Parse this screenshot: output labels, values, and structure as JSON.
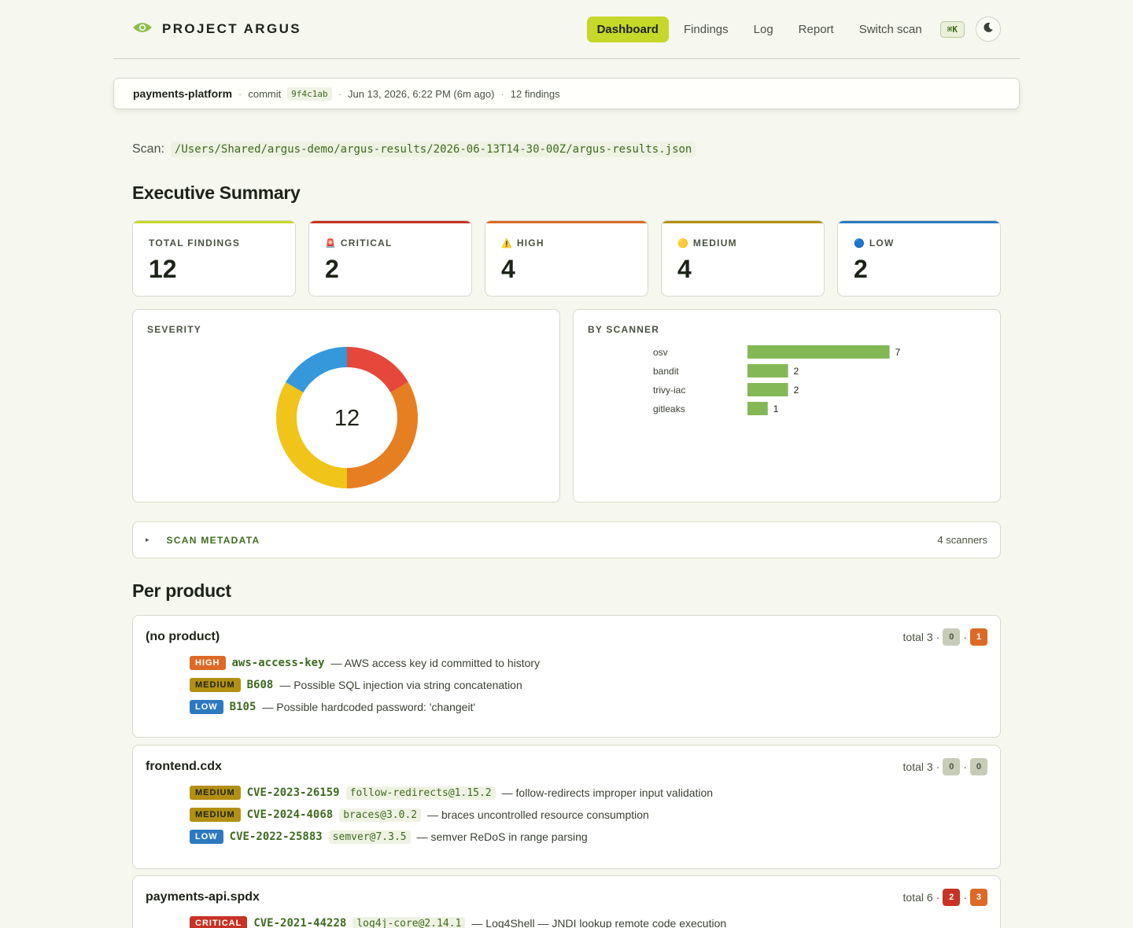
{
  "brand": {
    "name": "PROJECT ARGUS"
  },
  "nav": {
    "items": [
      {
        "label": "Dashboard",
        "active": true
      },
      {
        "label": "Findings",
        "active": false
      },
      {
        "label": "Log",
        "active": false
      },
      {
        "label": "Report",
        "active": false
      },
      {
        "label": "Switch scan",
        "active": false
      }
    ],
    "shortcut": "⌘K",
    "theme_icon": "moon-icon"
  },
  "scan_info": {
    "repo": "payments-platform",
    "commit_label": "commit",
    "commit": "9f4c1ab",
    "time": "Jun 13, 2026, 6:22 PM (6m ago)",
    "findings": "12 findings"
  },
  "scan_path": {
    "label": "Scan:",
    "path": "/Users/Shared/argus-demo/argus-results/2026-06-13T14-30-00Z/argus-results.json"
  },
  "summary": {
    "heading": "Executive Summary",
    "cards": [
      {
        "label": "TOTAL FINDINGS",
        "icon": "",
        "value": "12",
        "color": "#c6d82a"
      },
      {
        "label": "CRITICAL",
        "icon": "🚨",
        "value": "2",
        "color": "#c73324"
      },
      {
        "label": "HIGH",
        "icon": "⚠️",
        "value": "4",
        "color": "#dc6a26"
      },
      {
        "label": "MEDIUM",
        "icon": "🟡",
        "value": "4",
        "color": "#b29013"
      },
      {
        "label": "LOW",
        "icon": "🔵",
        "value": "2",
        "color": "#2d79c1"
      }
    ]
  },
  "severity_panel": {
    "title": "SEVERITY",
    "center": "12"
  },
  "scanner_panel": {
    "title": "BY SCANNER"
  },
  "chart_data": [
    {
      "type": "pie",
      "title": "SEVERITY",
      "categories": [
        "Critical",
        "High",
        "Medium",
        "Low"
      ],
      "values": [
        2,
        4,
        4,
        2
      ],
      "colors": [
        "#e5483b",
        "#e67e22",
        "#f0c419",
        "#3498db"
      ],
      "center_label": "12"
    },
    {
      "type": "bar",
      "title": "BY SCANNER",
      "categories": [
        "osv",
        "bandit",
        "trivy-iac",
        "gitleaks"
      ],
      "values": [
        7,
        2,
        2,
        1
      ],
      "color": "#84b857",
      "orientation": "horizontal"
    }
  ],
  "metadata": {
    "title": "SCAN METADATA",
    "count": "4 scanners"
  },
  "per_product": {
    "heading": "Per product",
    "products": [
      {
        "name": "(no product)",
        "total": "total 3",
        "c1": "0",
        "c2": "1",
        "findings": [
          {
            "sev": "HIGH",
            "id": "aws-access-key",
            "pkg": "",
            "desc": "— AWS access key id committed to history"
          },
          {
            "sev": "MEDIUM",
            "id": "B608",
            "pkg": "",
            "desc": "— Possible SQL injection via string concatenation"
          },
          {
            "sev": "LOW",
            "id": "B105",
            "pkg": "",
            "desc": "— Possible hardcoded password: 'changeit'"
          }
        ]
      },
      {
        "name": "frontend.cdx",
        "total": "total 3",
        "c1": "0",
        "c2": "0",
        "findings": [
          {
            "sev": "MEDIUM",
            "id": "CVE-2023-26159",
            "pkg": "follow-redirects@1.15.2",
            "desc": "— follow-redirects improper input validation"
          },
          {
            "sev": "MEDIUM",
            "id": "CVE-2024-4068",
            "pkg": "braces@3.0.2",
            "desc": "— braces uncontrolled resource consumption"
          },
          {
            "sev": "LOW",
            "id": "CVE-2022-25883",
            "pkg": "semver@7.3.5",
            "desc": "— semver ReDoS in range parsing"
          }
        ]
      },
      {
        "name": "payments-api.spdx",
        "total": "total 6",
        "c1": "2",
        "c2": "3",
        "findings": [
          {
            "sev": "CRITICAL",
            "id": "CVE-2021-44228",
            "pkg": "log4j-core@2.14.1",
            "desc": "— Log4Shell — JNDI lookup remote code execution"
          }
        ]
      }
    ]
  }
}
